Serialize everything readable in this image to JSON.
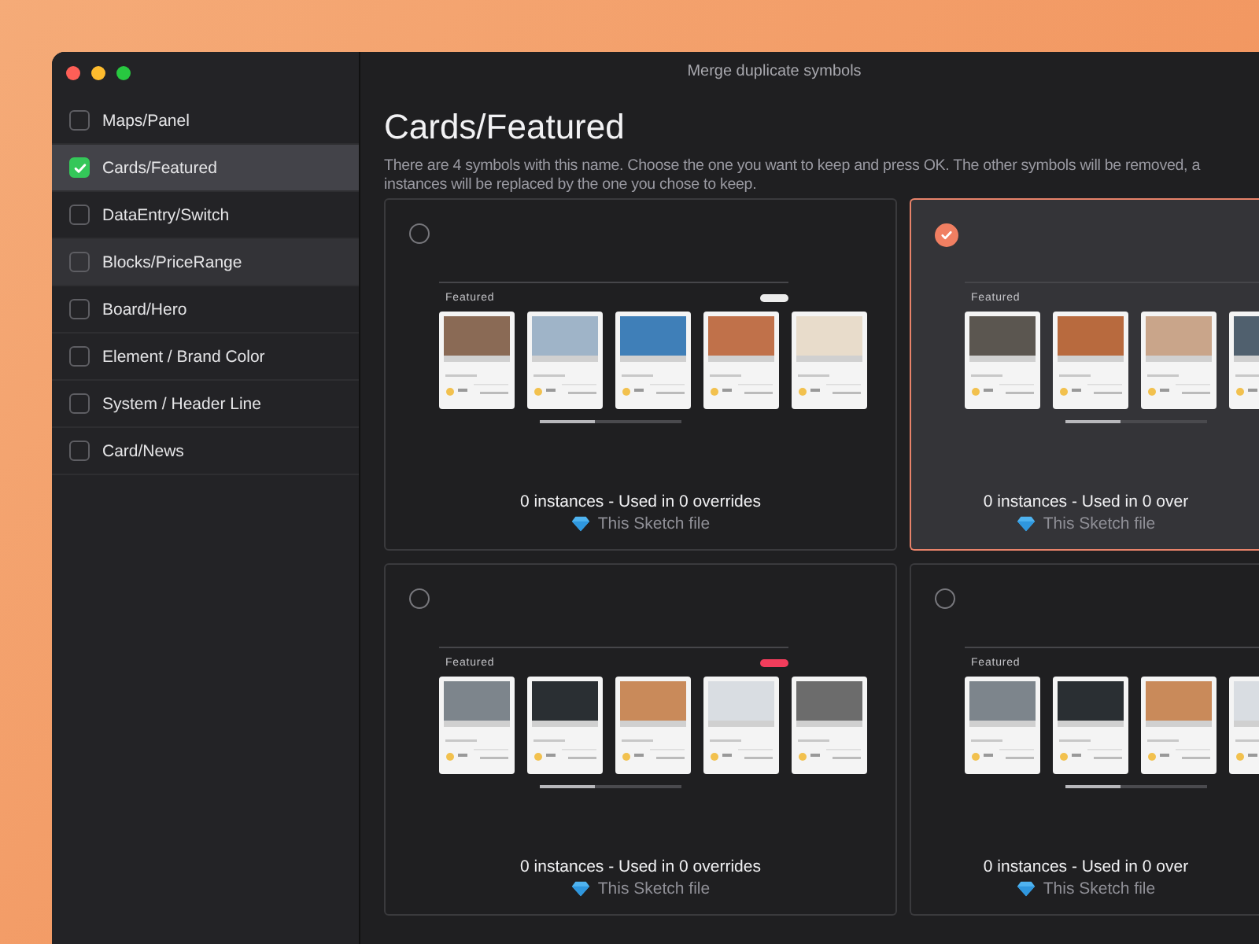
{
  "window": {
    "title": "Merge duplicate symbols"
  },
  "sidebar": {
    "items": [
      {
        "label": "Maps/Panel",
        "checked": false,
        "selected": false,
        "highlighted": false
      },
      {
        "label": "Cards/Featured",
        "checked": true,
        "selected": true,
        "highlighted": false
      },
      {
        "label": "DataEntry/Switch",
        "checked": false,
        "selected": false,
        "highlighted": false
      },
      {
        "label": "Blocks/PriceRange",
        "checked": false,
        "selected": false,
        "highlighted": true
      },
      {
        "label": "Board/Hero",
        "checked": false,
        "selected": false,
        "highlighted": false
      },
      {
        "label": "Element / Brand Color",
        "checked": false,
        "selected": false,
        "highlighted": false
      },
      {
        "label": "System / Header Line",
        "checked": false,
        "selected": false,
        "highlighted": false
      },
      {
        "label": "Card/News",
        "checked": false,
        "selected": false,
        "highlighted": false
      }
    ]
  },
  "main": {
    "heading": "Cards/Featured",
    "description": [
      "There are 4 symbols with this name. Choose the one you want to keep and press OK. The other symbols will be removed, a",
      "instances will be replaced by the one you chose to keep."
    ]
  },
  "options": [
    {
      "selected": false,
      "preview": {
        "heading": "Featured",
        "badge": {
          "color": "#ececec"
        }
      },
      "usage": "0 instances - Used in 0 overrides",
      "source": "This Sketch file"
    },
    {
      "selected": true,
      "preview": {
        "heading": "Featured"
      },
      "usage": "0 instances - Used in 0 over",
      "source": "This Sketch file"
    },
    {
      "selected": false,
      "preview": {
        "heading": "Featured",
        "badge": {
          "color": "#f23d5c"
        }
      },
      "usage": "0 instances - Used in 0 overrides",
      "source": "This Sketch file"
    },
    {
      "selected": false,
      "preview": {
        "heading": "Featured"
      },
      "usage": "0 instances - Used in 0 over",
      "source": "This Sketch file"
    }
  ]
}
